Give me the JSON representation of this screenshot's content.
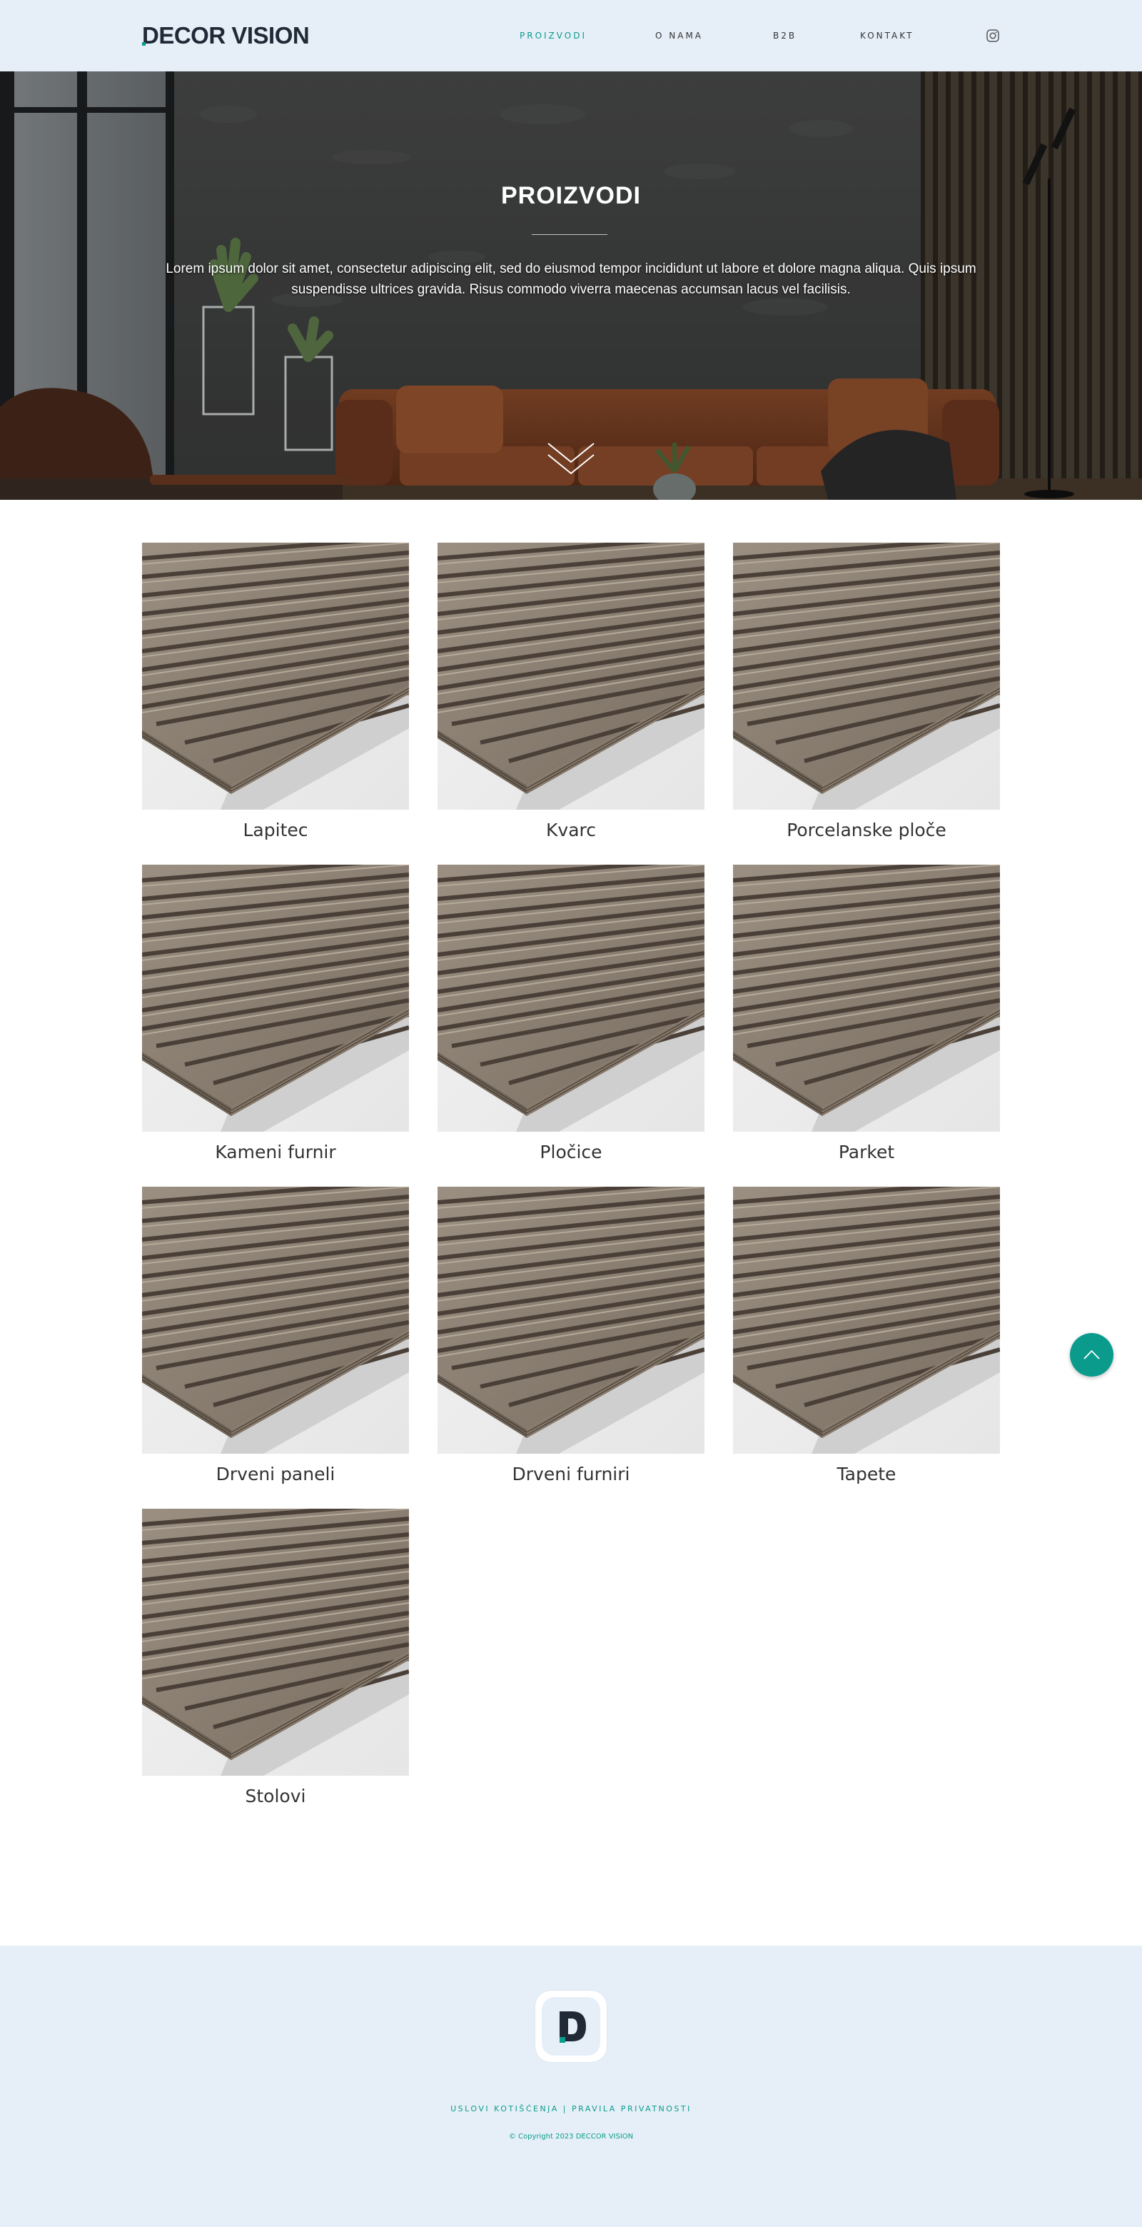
{
  "brand": {
    "name": "DECOR VISION"
  },
  "nav": {
    "items": [
      {
        "label": "PROIZVODI",
        "active": true
      },
      {
        "label": "O NAMA",
        "active": false
      },
      {
        "label": "B2B",
        "active": false
      },
      {
        "label": "KONTAKT",
        "active": false
      }
    ],
    "social_icon": "instagram-icon"
  },
  "hero": {
    "title": "PROIZVODI",
    "text": "Lorem ipsum dolor sit amet, consectetur adipiscing elit, sed do eiusmod tempor incididunt ut labore et dolore magna aliqua. Quis ipsum suspendisse ultrices gravida. Risus commodo viverra maecenas accumsan lacus vel facilisis.",
    "scroll_icon": "chevron-down-double-icon"
  },
  "products": [
    {
      "label": "Lapitec"
    },
    {
      "label": "Kvarc"
    },
    {
      "label": "Porcelanske ploče"
    },
    {
      "label": "Kameni furnir"
    },
    {
      "label": "Pločice"
    },
    {
      "label": "Parket"
    },
    {
      "label": "Drveni paneli"
    },
    {
      "label": "Drveni furniri"
    },
    {
      "label": "Tapete"
    },
    {
      "label": "Stolovi"
    }
  ],
  "back_to_top_icon": "chevron-up-icon",
  "footer": {
    "links": [
      "USLOVI KOTIŠĆENJA",
      "PRAVILA PRIVATNOSTI"
    ],
    "separator": "|",
    "copyright": "© Copyright 2023 DECCOR VISION"
  },
  "colors": {
    "accent": "#0a9b8c",
    "header_bg": "#e6eff8",
    "text": "#333333"
  }
}
